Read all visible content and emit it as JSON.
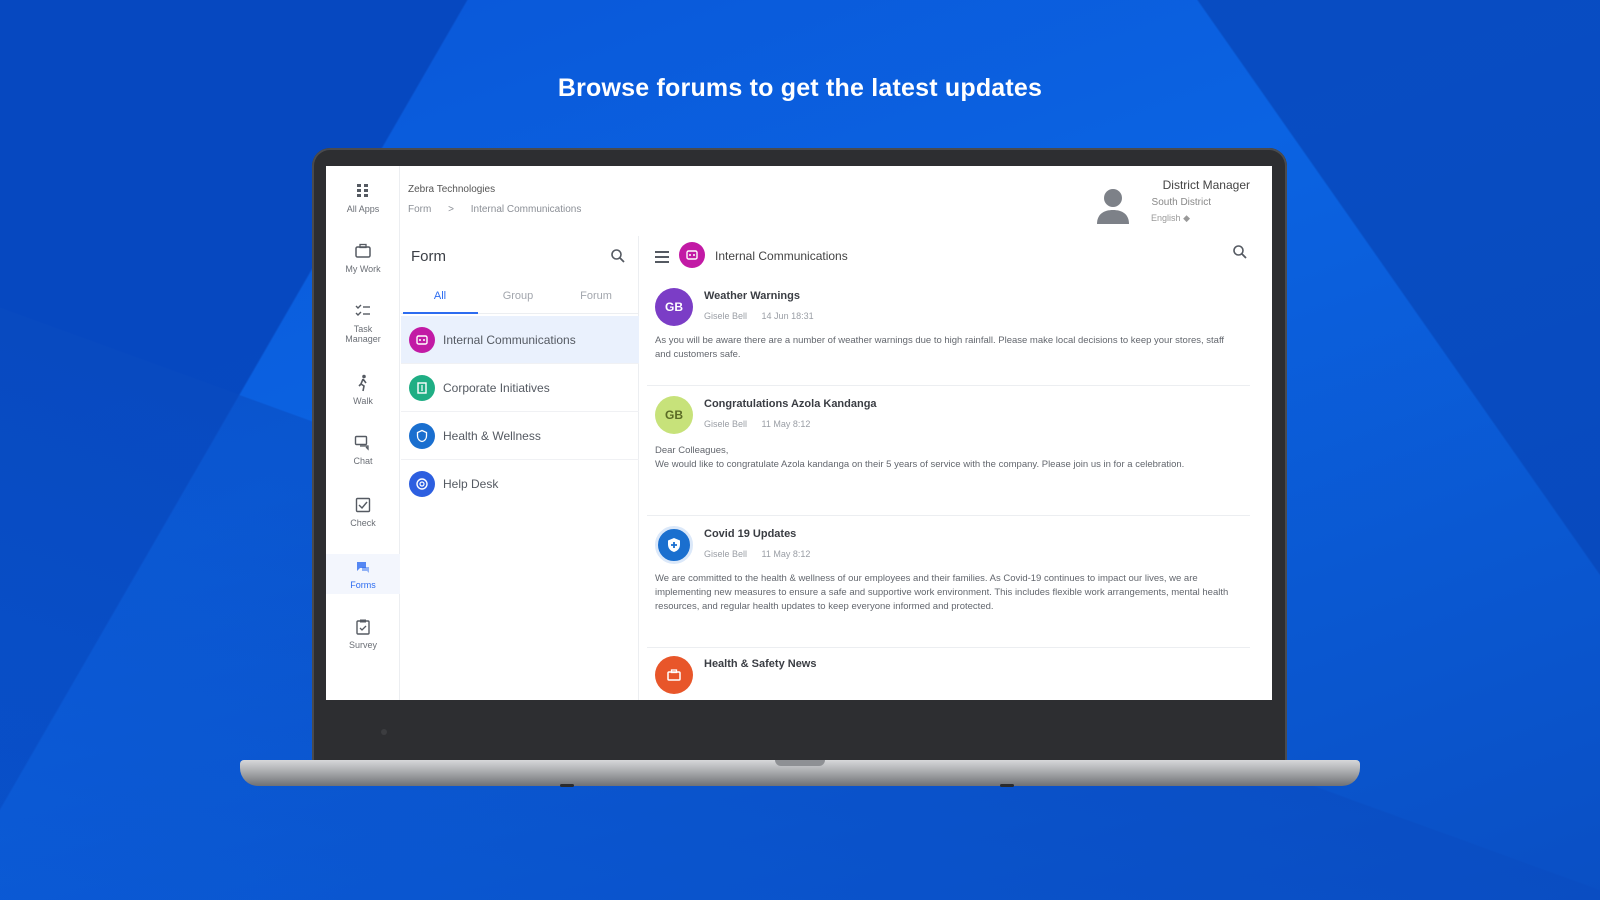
{
  "headline": "Browse forums to get the latest updates",
  "rail": [
    {
      "label": "All Apps",
      "icon": "grid-icon"
    },
    {
      "label": "My Work",
      "icon": "briefcase-icon"
    },
    {
      "label": "Task Manager",
      "icon": "task-list-icon"
    },
    {
      "label": "Walk",
      "icon": "walk-icon"
    },
    {
      "label": "Chat",
      "icon": "chat-icon"
    },
    {
      "label": "Check",
      "icon": "checklist-icon"
    },
    {
      "label": "Forms",
      "icon": "forums-icon"
    },
    {
      "label": "Survey",
      "icon": "survey-icon"
    }
  ],
  "header": {
    "org": "Zebra Technologies",
    "breadcrumb": [
      "Form",
      ">",
      "Internal Communications"
    ],
    "user_name": "District Manager",
    "user_district": "South District",
    "user_lang": "English ◆"
  },
  "list": {
    "title": "Form",
    "tabs": [
      "All",
      "Group",
      "Forum"
    ],
    "forums": [
      {
        "label": "Internal Communications",
        "color": "#c21aa5"
      },
      {
        "label": "Corporate Initiatives",
        "color": "#1fae84"
      },
      {
        "label": "Health & Wellness",
        "color": "#1a6fcf"
      },
      {
        "label": "Help Desk",
        "color": "#2d5fe0"
      }
    ]
  },
  "feed": {
    "title": "Internal Communications",
    "posts": [
      {
        "initials": "GB",
        "avatar_color": "#7b3dc6",
        "title": "Weather Warnings",
        "author": "Gisele Bell",
        "date": "14 Jun 18:31",
        "body": "As you will be aware there are a number of weather warnings due to high rainfall. Please make local decisions to keep your stores, staff and customers safe."
      },
      {
        "initials": "GB",
        "avatar_color": "#c7e27a",
        "title": "Congratulations Azola Kandanga",
        "author": "Gisele Bell",
        "date": "11 May 8:12",
        "body": "Dear Colleagues,\nWe would like to congratulate Azola kandanga on their 5 years of service with the company. Please join us in for a celebration."
      },
      {
        "initials": "",
        "avatar_color": "#1a6fcf",
        "title": "Covid 19 Updates",
        "author": "Gisele Bell",
        "date": "11 May 8:12",
        "body": "We are committed to the health & wellness of our employees and their families. As Covid-19 continues to impact our lives, we are implementing new measures to ensure a safe and supportive work environment. This includes flexible work arrangements, mental health resources, and regular health updates to keep everyone informed and protected."
      },
      {
        "initials": "",
        "avatar_color": "#e8562a",
        "title": "Health & Safety News",
        "author": "",
        "date": "",
        "body": ""
      }
    ]
  }
}
